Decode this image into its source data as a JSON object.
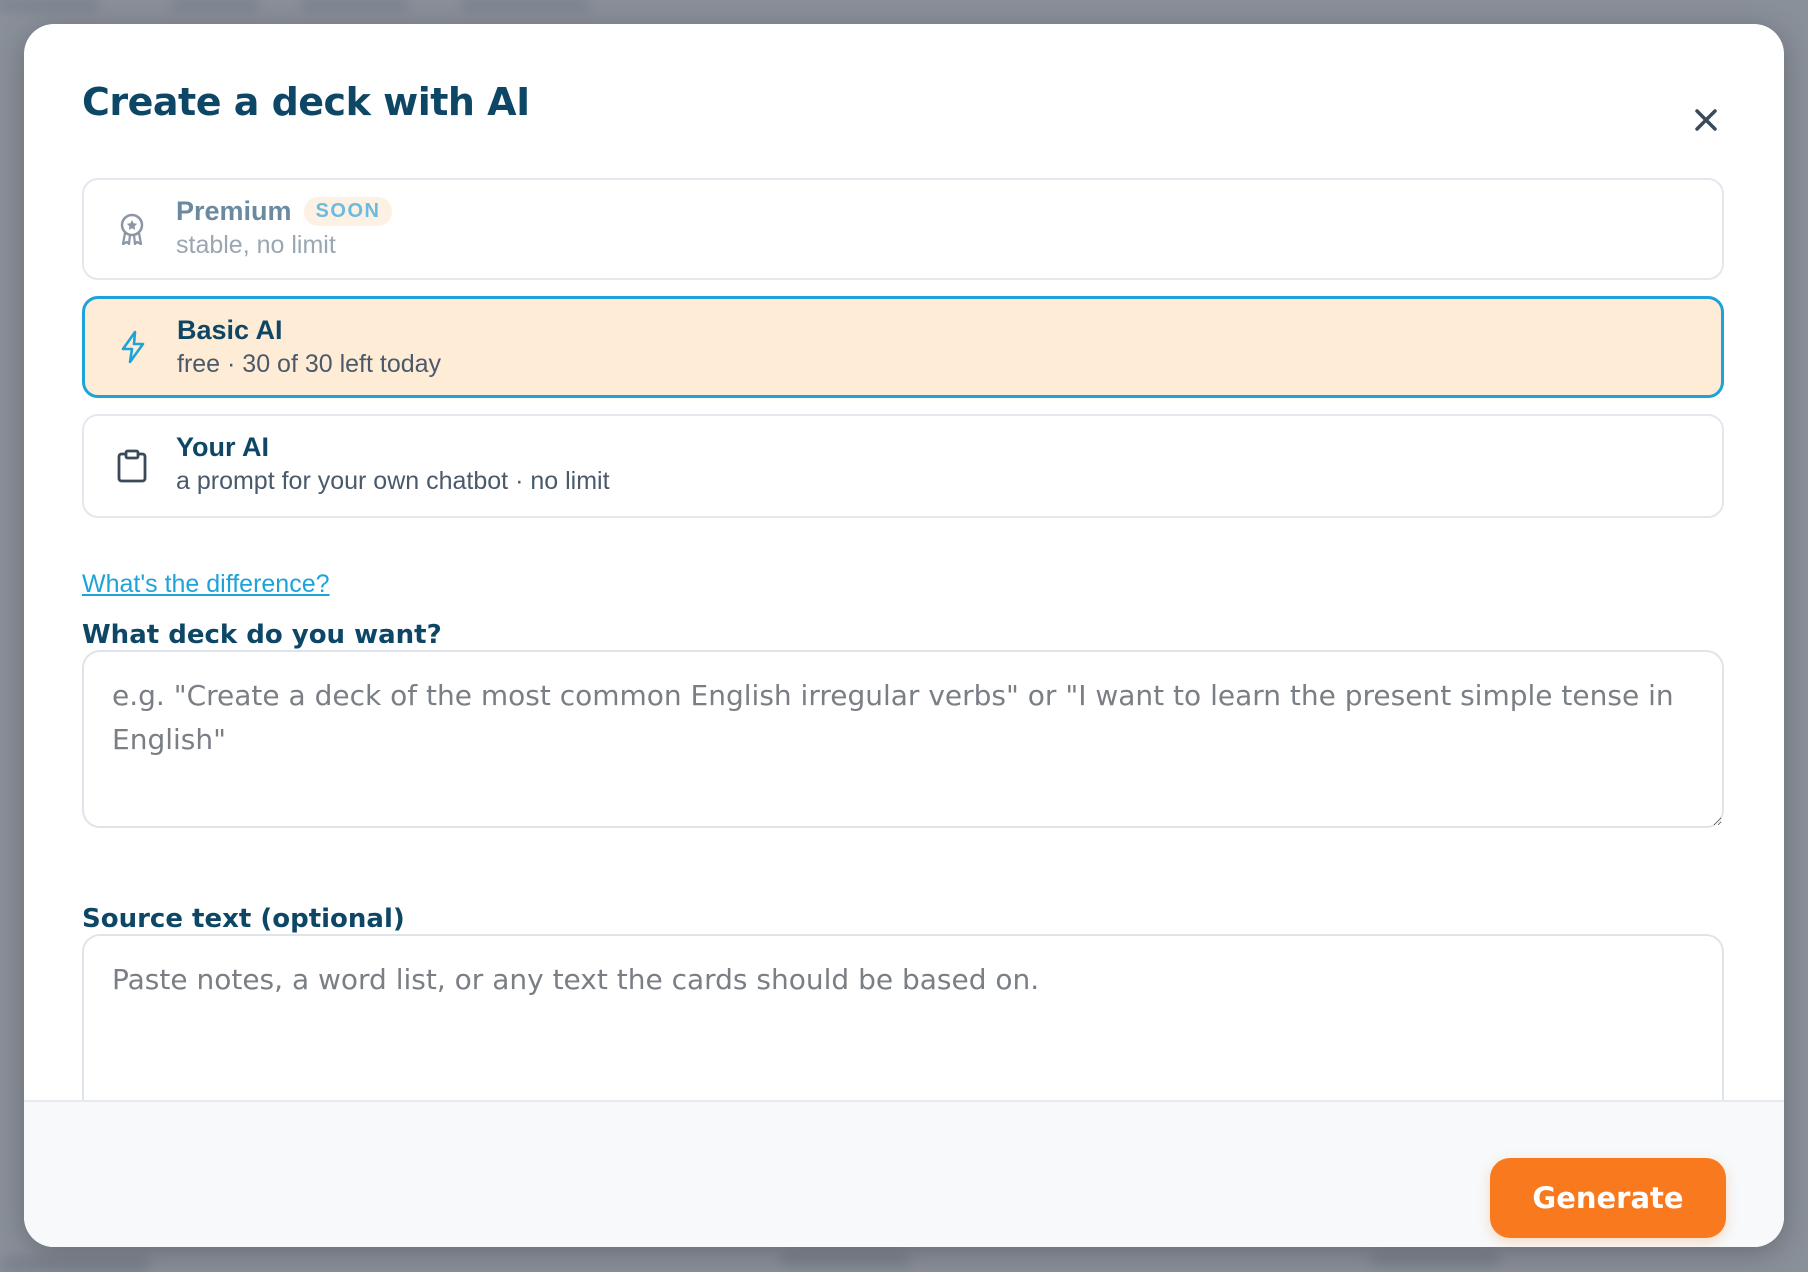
{
  "modal": {
    "title": "Create a deck with AI"
  },
  "options": [
    {
      "icon": "award-ribbon-icon",
      "title": "Premium",
      "badge": "SOON",
      "subtitle": "stable, no limit",
      "selected": false,
      "disabled": true
    },
    {
      "icon": "lightning-bolt-icon",
      "title": "Basic AI",
      "subtitle": "free · 30 of 30 left today",
      "selected": true
    },
    {
      "icon": "clipboard-icon",
      "title": "Your AI",
      "subtitle": "a prompt for your own chatbot · no limit",
      "selected": false
    }
  ],
  "difference_link": "What's the difference?",
  "deck_field": {
    "label": "What deck do you want?",
    "value": "",
    "placeholder": "e.g. \"Create a deck of the most common English irregular verbs\" or \"I want to learn the present simple tense in English\""
  },
  "source_field": {
    "label": "Source text (optional)",
    "value": "",
    "placeholder": "Paste notes, a word list, or any text the cards should be based on."
  },
  "footer": {
    "generate_label": "Generate"
  },
  "colors": {
    "accent": "#1ea3d9",
    "heading": "#0e4766",
    "selected_bg": "#ffecd6",
    "generate": "#f97a1e"
  }
}
